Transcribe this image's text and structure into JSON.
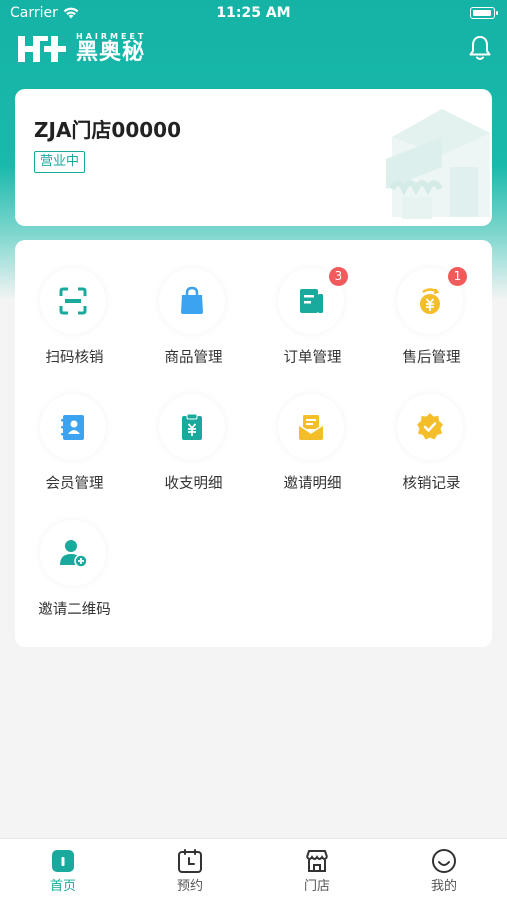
{
  "status_bar": {
    "carrier": "Carrier",
    "time": "11:25 AM"
  },
  "header": {
    "logo_en": "HAIRMEET",
    "logo_cn": "黑奥秘"
  },
  "store": {
    "name": "ZJA门店00000",
    "status": "营业中"
  },
  "menu": [
    {
      "label": "扫码核销",
      "icon": "scan-icon",
      "badge": ""
    },
    {
      "label": "商品管理",
      "icon": "shopping-bag-icon",
      "badge": ""
    },
    {
      "label": "订单管理",
      "icon": "order-book-icon",
      "badge": "3"
    },
    {
      "label": "售后管理",
      "icon": "coin-icon",
      "badge": "1"
    },
    {
      "label": "会员管理",
      "icon": "member-book-icon",
      "badge": ""
    },
    {
      "label": "收支明细",
      "icon": "clipboard-yuan-icon",
      "badge": ""
    },
    {
      "label": "邀请明细",
      "icon": "envelope-icon",
      "badge": ""
    },
    {
      "label": "核销记录",
      "icon": "check-badge-icon",
      "badge": ""
    },
    {
      "label": "邀请二维码",
      "icon": "add-user-icon",
      "badge": ""
    }
  ],
  "tabbar": [
    {
      "label": "首页",
      "icon": "home-icon",
      "active": true
    },
    {
      "label": "预约",
      "icon": "calendar-clock-icon",
      "active": false
    },
    {
      "label": "门店",
      "icon": "store-icon",
      "active": false
    },
    {
      "label": "我的",
      "icon": "smile-icon",
      "active": false
    }
  ],
  "colors": {
    "brand": "#1aa99d",
    "badge": "#f25b5b",
    "accent_blue": "#3ba3f0",
    "accent_yellow": "#f4bd2a"
  }
}
